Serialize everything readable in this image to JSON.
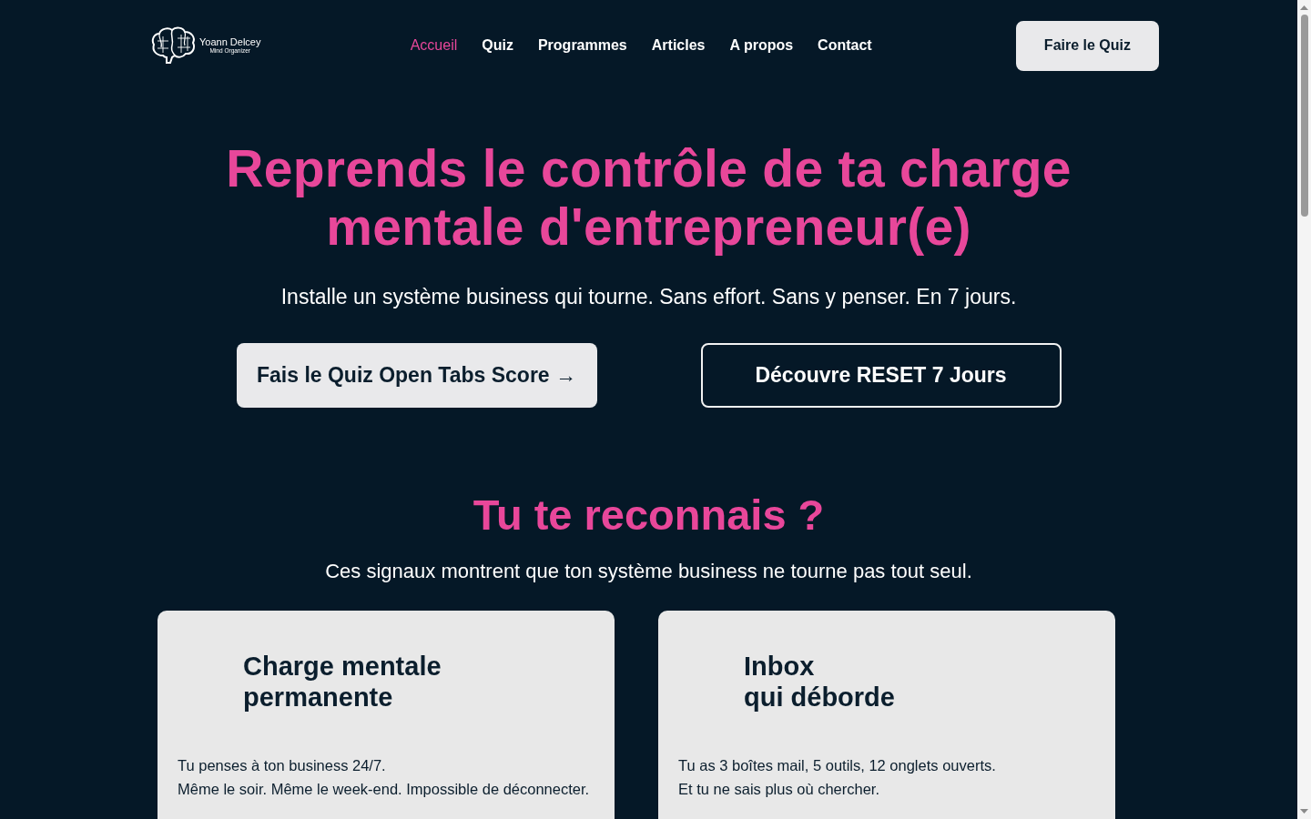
{
  "header": {
    "logo": {
      "name": "Yoann Delcey",
      "tagline": "Mind Organizer"
    },
    "nav": [
      {
        "label": "Accueil",
        "selected": true
      },
      {
        "label": "Quiz",
        "selected": false
      },
      {
        "label": "Programmes",
        "selected": false
      },
      {
        "label": "Articles",
        "selected": false
      },
      {
        "label": "A propos",
        "selected": false
      },
      {
        "label": "Contact",
        "selected": false
      }
    ],
    "cta": "Faire le Quiz"
  },
  "hero": {
    "title_lines": [
      "Reprends le contrôle de ta charge",
      "mentale d'entrepreneur(e)"
    ],
    "subtitle": "Installe un système business qui tourne. Sans effort. Sans y penser. En 7 jours.",
    "buttons": [
      {
        "label": "Fais le Quiz Open Tabs Score →",
        "kind": "primary"
      },
      {
        "label": "Découvre RESET 7 Jours",
        "kind": "outline"
      }
    ]
  },
  "section": {
    "title": "Tu te reconnais ?",
    "subtitle": "Ces signaux montrent que ton système business ne tourne pas tout seul.",
    "cards": [
      {
        "title_lines": [
          "Charge mentale",
          "permanente"
        ],
        "text_lines": [
          "Tu penses à ton business 24/7.",
          "Même le soir. Même le week-end. Impossible de déconnecter."
        ]
      },
      {
        "title_lines": [
          "Inbox",
          "qui déborde"
        ],
        "text_lines": [
          "Tu as 3 boîtes mail, 5 outils, 12 onglets ouverts.",
          "Et tu ne sais plus où chercher."
        ]
      }
    ]
  }
}
